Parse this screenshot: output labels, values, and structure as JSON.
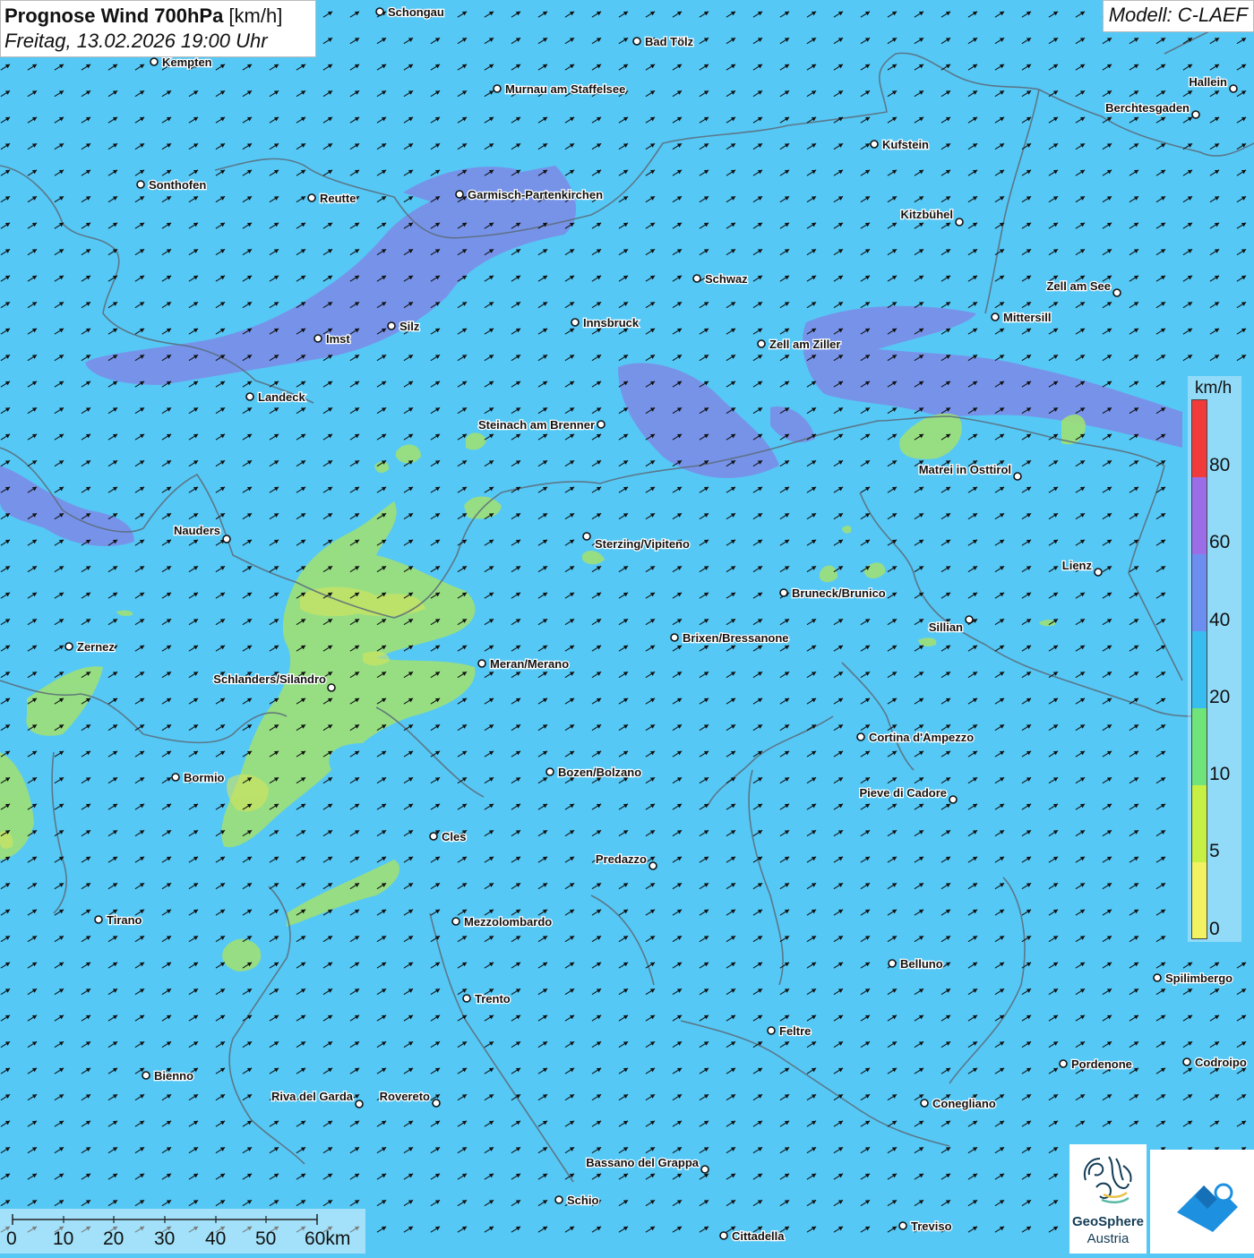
{
  "title": {
    "bold": "Prognose Wind 700hPa",
    "unit": " [km/h]",
    "datetime": "Freitag, 13.02.2026 19:00 Uhr"
  },
  "model": "Modell: C-LAEF",
  "legend": {
    "unit": "km/h",
    "labels": [
      "80",
      "60",
      "40",
      "20",
      "10",
      "5",
      "0"
    ],
    "colors": [
      "#f0433a",
      "#f13b3b",
      "#9b6ee8",
      "#6b8ef0",
      "#37bdf0",
      "#6fe47a",
      "#c6f043",
      "#f3f263"
    ]
  },
  "scalebar": {
    "labels": [
      "0",
      "10",
      "20",
      "30",
      "40",
      "50",
      "60km"
    ]
  },
  "logo": {
    "name": "GeoSphere",
    "sub": "Austria"
  },
  "wind": {
    "direction": "southwest",
    "field_color": "#56c8f5"
  },
  "cities": [
    {
      "name": "Schongau"
    },
    {
      "name": "Bad Tölz"
    },
    {
      "name": "Kempten"
    },
    {
      "name": "Murnau am Staffelsee"
    },
    {
      "name": "Hallein"
    },
    {
      "name": "Berchtesgaden"
    },
    {
      "name": "Kufstein"
    },
    {
      "name": "Sonthofen"
    },
    {
      "name": "Reutte"
    },
    {
      "name": "Garmisch-Partenkirchen"
    },
    {
      "name": "Kitzbühel"
    },
    {
      "name": "Schwaz"
    },
    {
      "name": "Zell am See"
    },
    {
      "name": "Mittersill"
    },
    {
      "name": "Silz"
    },
    {
      "name": "Innsbruck"
    },
    {
      "name": "Imst"
    },
    {
      "name": "Zell am Ziller"
    },
    {
      "name": "Landeck"
    },
    {
      "name": "Steinach am Brenner"
    },
    {
      "name": "Matrei in Osttirol"
    },
    {
      "name": "Nauders"
    },
    {
      "name": "Sterzing/Vipiteno"
    },
    {
      "name": "Lienz"
    },
    {
      "name": "Bruneck/Brunico"
    },
    {
      "name": "Sillian"
    },
    {
      "name": "Zernez"
    },
    {
      "name": "Brixen/Bressanone"
    },
    {
      "name": "Meran/Merano"
    },
    {
      "name": "Schlanders/Silandro"
    },
    {
      "name": "Cortina d'Ampezzo"
    },
    {
      "name": "Bormio"
    },
    {
      "name": "Bozen/Bolzano"
    },
    {
      "name": "Pieve di Cadore"
    },
    {
      "name": "Cles"
    },
    {
      "name": "Predazzo"
    },
    {
      "name": "Tirano"
    },
    {
      "name": "Mezzolombardo"
    },
    {
      "name": "Belluno"
    },
    {
      "name": "Spilimbergo"
    },
    {
      "name": "Trento"
    },
    {
      "name": "Feltre"
    },
    {
      "name": "Pordenone"
    },
    {
      "name": "Codroipo"
    },
    {
      "name": "Bienno"
    },
    {
      "name": "Riva del Garda"
    },
    {
      "name": "Rovereto"
    },
    {
      "name": "Conegliano"
    },
    {
      "name": "Bassano del Grappa"
    },
    {
      "name": "Schio"
    },
    {
      "name": "Treviso"
    },
    {
      "name": "Cittadella"
    }
  ]
}
